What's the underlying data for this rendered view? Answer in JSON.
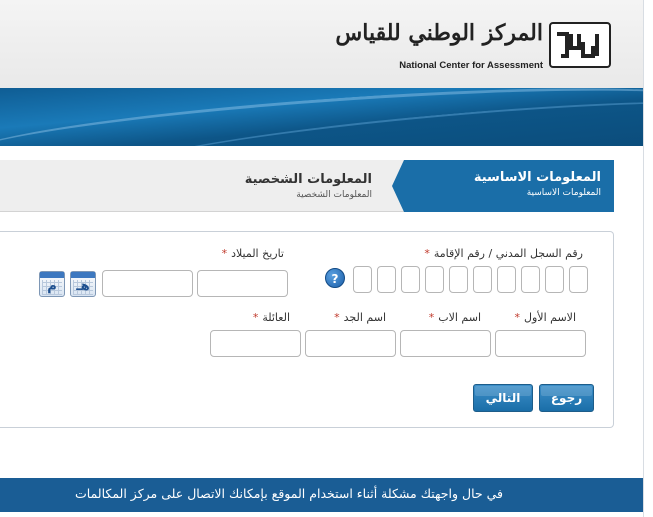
{
  "header": {
    "logo_ar": "المركز الوطني للقياس",
    "logo_en": "National Center for Assessment",
    "logo_mark_icon": "qiyas-logo-mark"
  },
  "steps": {
    "active": {
      "title": "المعلومات الاساسية",
      "subtitle": "المعلومات الاساسية"
    },
    "next": {
      "title": "المعلومات الشخصية",
      "subtitle": "المعلومات الشخصية"
    }
  },
  "form": {
    "id_label": "رقم السجل المدني / رقم الإقامة",
    "dob_label": "تاريخ الميلاد",
    "required_mark": "*",
    "help_icon": "help-icon",
    "help_glyph": "?",
    "hijri_cal_glyph": "هـ",
    "gregorian_cal_glyph": "م",
    "first_name_label": "الاسم الأول",
    "father_name_label": "اسم الاب",
    "grandfather_name_label": "اسم الجد",
    "family_name_label": "العائلة"
  },
  "buttons": {
    "back": "رجوع",
    "next": "التالي"
  },
  "footer": {
    "text": "في حال واجهتك مشكلة أثناء استخدام الموقع بإمكانك الاتصال على مركز المكالمات"
  },
  "colors": {
    "primary_blue": "#1a6ea8",
    "banner_blue": "#0f5d94",
    "footer_blue": "#1a5d95",
    "required_red": "#c0392b"
  }
}
